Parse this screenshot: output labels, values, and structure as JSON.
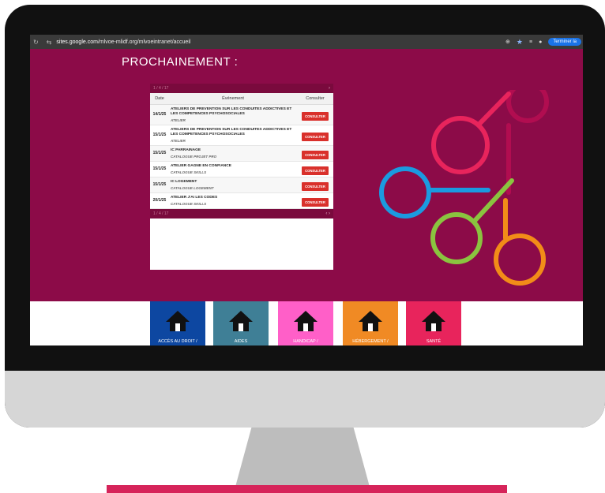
{
  "browser": {
    "url_domain": "sites.google.com",
    "url_path": "/mlvoe-mlidf.org/mlvoeintranet/accueil",
    "finish_button": "Terminer la"
  },
  "page": {
    "heading": "PROCHAINEMENT :"
  },
  "calendar": {
    "nav_label": "1 / 4 / 17",
    "columns": {
      "date": "Date",
      "event": "Événement",
      "action": "Consulter"
    },
    "rows": [
      {
        "date": "14/1/25",
        "title": "ATELIERS DE PREVENTION SUR LES CONDUITES ADDICTIVES ET LES COMPETENCES PSYCHOSOCIALES",
        "category": "ATELIER",
        "button": "CONSULTER"
      },
      {
        "date": "15/1/25",
        "title": "ATELIERS DE PREVENTION SUR LES CONDUITES ADDICTIVES ET LES COMPETENCES PSYCHOSOCIALES",
        "category": "ATELIER",
        "button": "CONSULTER"
      },
      {
        "date": "15/1/25",
        "title": "IC PARRAINAGE",
        "category": "CATALOGUE PROJET PRO",
        "button": "CONSULTER"
      },
      {
        "date": "15/1/25",
        "title": "ATELIER GAGNE EN CONFIANCE",
        "category": "CATALOGUE SKILLS",
        "button": "CONSULTER"
      },
      {
        "date": "15/1/25",
        "title": "IC LOGEMENT",
        "category": "CATALOGUE LOGEMENT",
        "button": "CONSULTER"
      },
      {
        "date": "20/1/25",
        "title": "ATELIER J'AI LES CODES",
        "category": "CATALOGUE SKILLS",
        "button": "CONSULTER"
      }
    ]
  },
  "tiles": [
    {
      "label": "ACCÈS AU DROIT /",
      "color": "#0d47a1"
    },
    {
      "label": "AIDES",
      "color": "#3f7f96"
    },
    {
      "label": "HANDICAP /",
      "color": "#ff5fc8"
    },
    {
      "label": "HÉBERGEMENT /",
      "color": "#f08a24"
    },
    {
      "label": "SANTÉ",
      "color": "#e8245c"
    }
  ],
  "colors": {
    "background": "#8c0b48",
    "button": "#d9302b",
    "stand_base": "#d6245a"
  }
}
